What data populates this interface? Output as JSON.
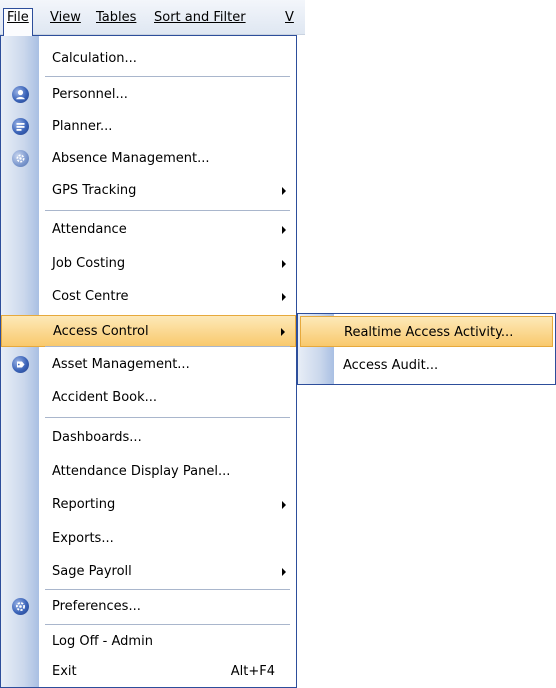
{
  "menubar": {
    "items": [
      {
        "label": "File",
        "mnemonic": "F"
      },
      {
        "label": "View",
        "mnemonic": "V"
      },
      {
        "label": "Tables",
        "mnemonic": "T"
      },
      {
        "label": "Sort and Filter",
        "mnemonic": "S"
      },
      {
        "label": "V",
        "mnemonic": ""
      }
    ]
  },
  "file_menu": {
    "items": [
      {
        "label": "Calculation...",
        "icon": null,
        "submenu": false
      },
      {
        "label": "Personnel...",
        "icon": "person-icon",
        "submenu": false
      },
      {
        "label": "Planner...",
        "icon": "planner-icon",
        "submenu": false
      },
      {
        "label": "Absence Management...",
        "icon": "absence-gear-icon",
        "submenu": false
      },
      {
        "label": "GPS Tracking",
        "icon": null,
        "submenu": true
      },
      {
        "label": "Attendance",
        "icon": null,
        "submenu": true
      },
      {
        "label": "Job Costing",
        "icon": null,
        "submenu": true
      },
      {
        "label": "Cost Centre",
        "icon": null,
        "submenu": true
      },
      {
        "label": "Access Control",
        "icon": null,
        "submenu": true,
        "highlighted": true
      },
      {
        "label": "Asset Management...",
        "icon": "tag-icon",
        "submenu": false
      },
      {
        "label": "Accident Book...",
        "icon": null,
        "submenu": false
      },
      {
        "label": "Dashboards...",
        "icon": null,
        "submenu": false
      },
      {
        "label": "Attendance Display Panel...",
        "icon": null,
        "submenu": false
      },
      {
        "label": "Reporting",
        "icon": null,
        "submenu": true
      },
      {
        "label": "Exports...",
        "icon": null,
        "submenu": false
      },
      {
        "label": "Sage Payroll",
        "icon": null,
        "submenu": true
      },
      {
        "label": "Preferences...",
        "icon": "preferences-gear-icon",
        "submenu": false
      },
      {
        "label": "Log Off - Admin",
        "icon": null,
        "submenu": false
      },
      {
        "label": "Exit",
        "icon": null,
        "submenu": false,
        "shortcut": "Alt+F4"
      }
    ]
  },
  "access_control_submenu": {
    "items": [
      {
        "label": "Realtime Access Activity...",
        "highlighted": true
      },
      {
        "label": "Access Audit..."
      }
    ]
  },
  "colors": {
    "menu_border": "#2d4e9b",
    "highlight_top": "#fde9b8",
    "highlight_bottom": "#f9c96d",
    "highlight_border": "#e6a93c",
    "icon_blue": "#3a63b8"
  }
}
